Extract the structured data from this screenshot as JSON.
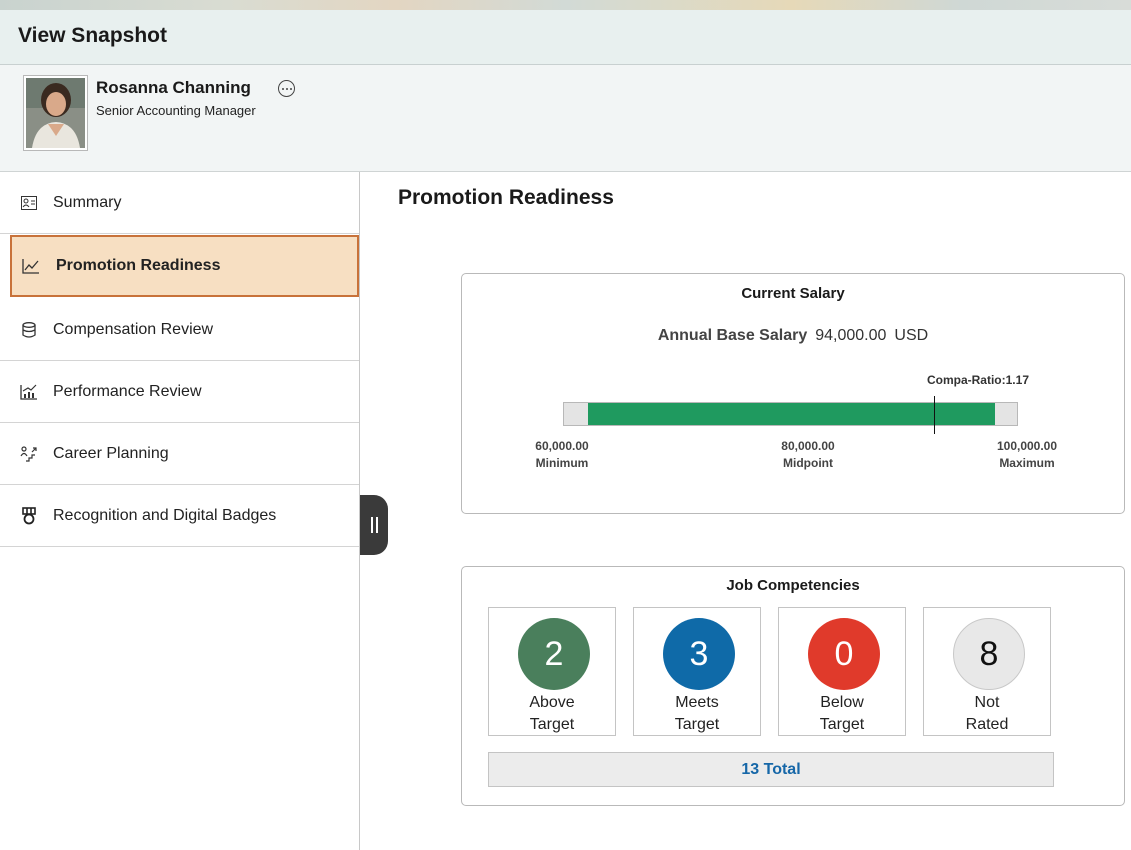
{
  "header": {
    "title": "View Snapshot"
  },
  "profile": {
    "name": "Rosanna Channing",
    "job_title": "Senior Accounting Manager"
  },
  "sidebar": {
    "items": [
      {
        "label": "Summary",
        "icon": "id-card-icon",
        "active": false
      },
      {
        "label": "Promotion Readiness",
        "icon": "line-chart-icon",
        "active": true
      },
      {
        "label": "Compensation Review",
        "icon": "database-icon",
        "active": false
      },
      {
        "label": "Performance Review",
        "icon": "bar-chart-trend-icon",
        "active": false
      },
      {
        "label": "Career Planning",
        "icon": "career-steps-icon",
        "active": false
      },
      {
        "label": "Recognition and Digital Badges",
        "icon": "badge-medal-icon",
        "active": false
      }
    ]
  },
  "main": {
    "page_title": "Promotion Readiness"
  },
  "current_salary": {
    "title": "Current Salary",
    "label": "Annual Base Salary",
    "amount": "94,000.00",
    "currency": "USD",
    "compa_ratio": "Compa-Ratio:1.17",
    "minimum_value": "60,000.00",
    "minimum_label": "Minimum",
    "midpoint_value": "80,000.00",
    "midpoint_label": "Midpoint",
    "maximum_value": "100,000.00",
    "maximum_label": "Maximum"
  },
  "competencies": {
    "title": "Job Competencies",
    "tiles": [
      {
        "count": "2",
        "line1": "Above",
        "line2": "Target",
        "color": "#4a7f5c"
      },
      {
        "count": "3",
        "line1": "Meets",
        "line2": "Target",
        "color": "#0f6aa8"
      },
      {
        "count": "0",
        "line1": "Below",
        "line2": "Target",
        "color": "#e03a2b"
      },
      {
        "count": "8",
        "line1": "Not",
        "line2": "Rated",
        "color": "#e8e8e8"
      }
    ],
    "total": "13 Total"
  },
  "colors": {
    "active_nav_bg": "#f7dfc2",
    "active_nav_border": "#c8723a",
    "salary_bar": "#1f9a5f",
    "total_text": "#1667a8"
  }
}
